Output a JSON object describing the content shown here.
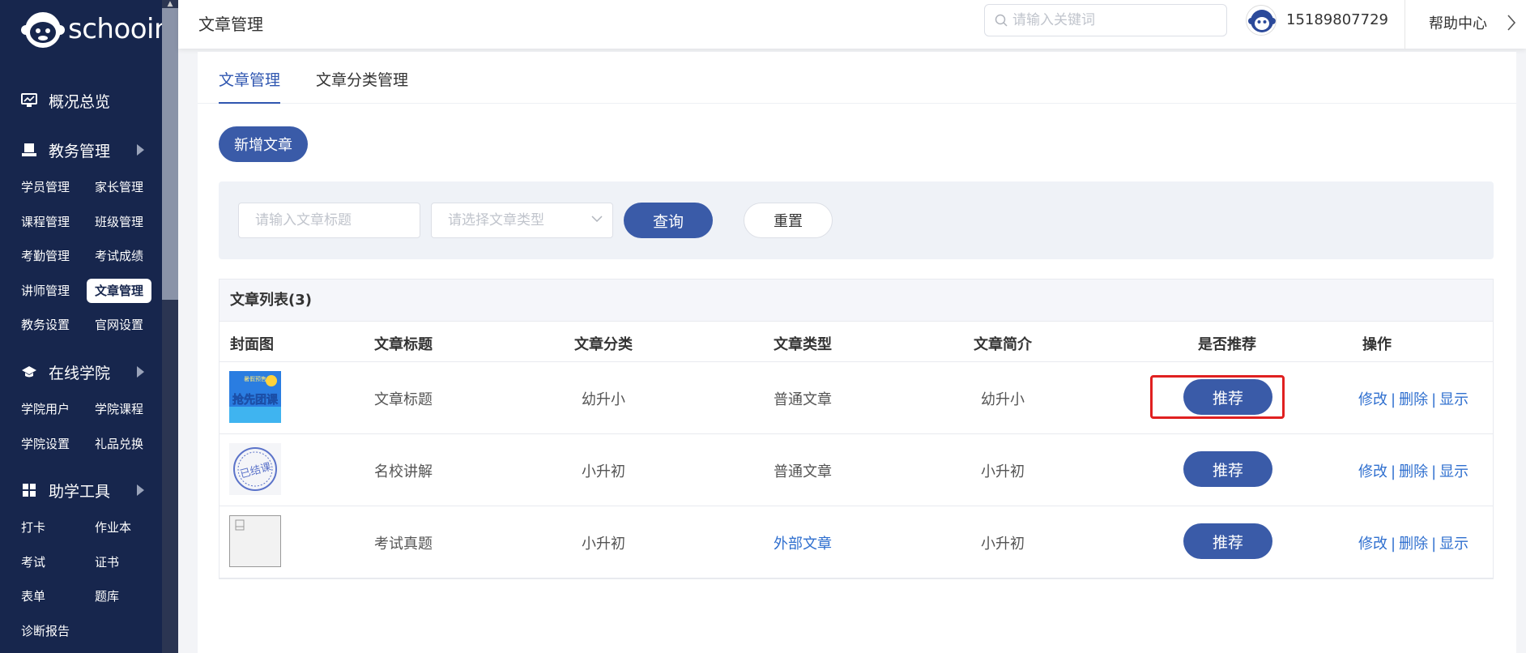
{
  "brand": {
    "name": "schooin"
  },
  "header": {
    "title": "文章管理",
    "search_placeholder": "请输入关键词",
    "phone": "15189807729",
    "help": "帮助中心"
  },
  "sidebar": {
    "overview": "概况总览",
    "sections": [
      {
        "label": "教务管理",
        "items": [
          "学员管理",
          "家长管理",
          "课程管理",
          "班级管理",
          "考勤管理",
          "考试成绩",
          "讲师管理",
          "文章管理",
          "教务设置",
          "官网设置"
        ]
      },
      {
        "label": "在线学院",
        "items": [
          "学院用户",
          "学院课程",
          "学院设置",
          "礼品兑换"
        ]
      },
      {
        "label": "助学工具",
        "items": [
          "打卡",
          "作业本",
          "考试",
          "证书",
          "表单",
          "题库",
          "诊断报告"
        ]
      }
    ],
    "active_item": "文章管理"
  },
  "tabs": [
    {
      "label": "文章管理",
      "active": true
    },
    {
      "label": "文章分类管理",
      "active": false
    }
  ],
  "add_button": "新增文章",
  "filter": {
    "title_placeholder": "请输入文章标题",
    "type_placeholder": "请选择文章类型",
    "query": "查询",
    "reset": "重置"
  },
  "list": {
    "heading": "文章列表(3)",
    "columns": [
      "封面图",
      "文章标题",
      "文章分类",
      "文章类型",
      "文章简介",
      "是否推荐",
      "操作"
    ],
    "rows": [
      {
        "title": "文章标题",
        "category": "幼升小",
        "type": "普通文章",
        "summary": "幼升小",
        "recommend": "推荐",
        "ops": [
          "修改",
          "删除",
          "显示"
        ],
        "cover_text": "抢先团课",
        "cover_small": "暑假预售"
      },
      {
        "title": "名校讲解",
        "category": "小升初",
        "type": "普通文章",
        "summary": "小升初",
        "recommend": "推荐",
        "ops": [
          "修改",
          "删除",
          "显示"
        ],
        "cover_text": "已结课"
      },
      {
        "title": "考试真题",
        "category": "小升初",
        "type": "外部文章",
        "summary": "小升初",
        "recommend": "推荐",
        "ops": [
          "修改",
          "删除",
          "显示"
        ]
      }
    ]
  },
  "colors": {
    "sidebar": "#17264d",
    "primary": "#3a5ba8",
    "link": "#2f6fcf",
    "highlight": "#e02020"
  }
}
